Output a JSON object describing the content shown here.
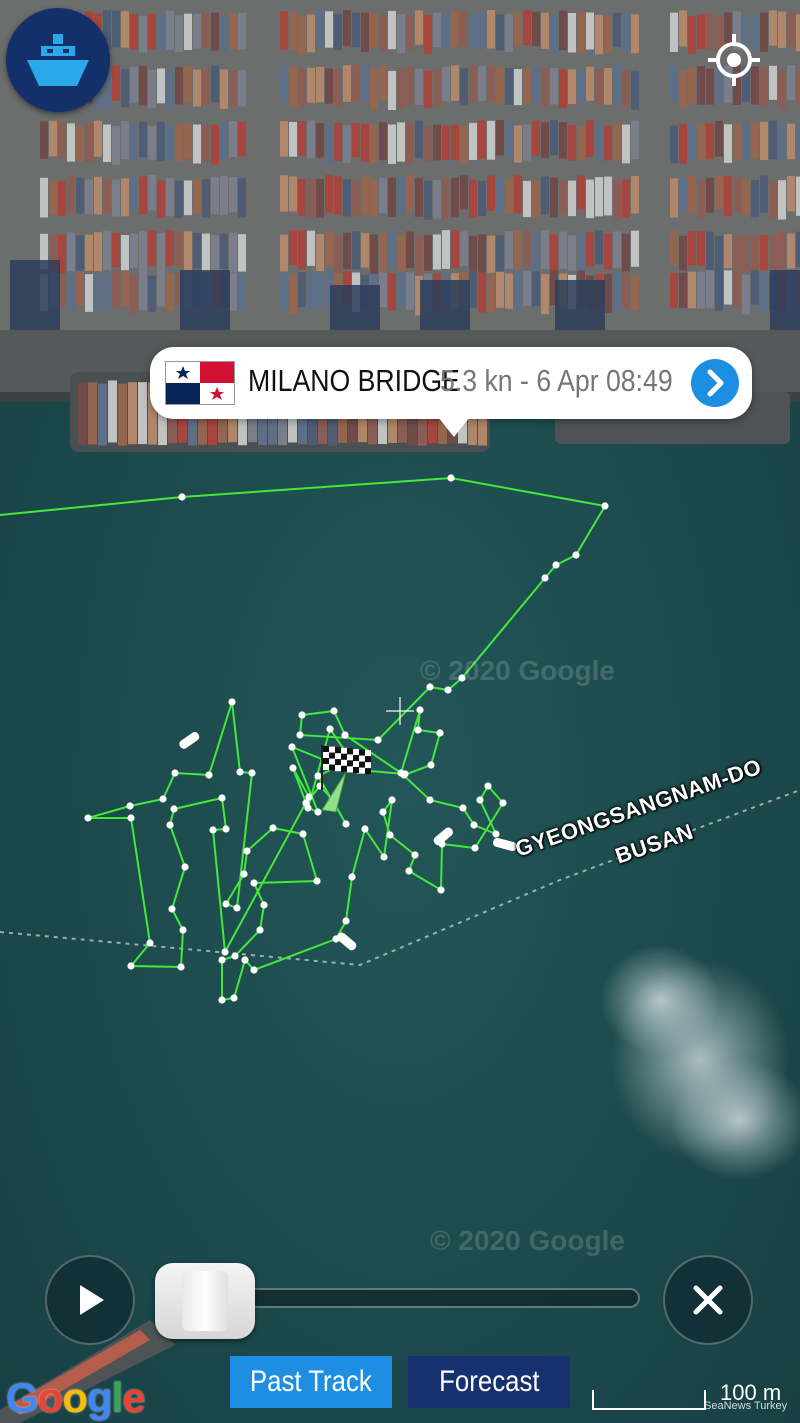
{
  "app": {
    "logo_icon": "ship-icon",
    "locate_icon": "locate-icon"
  },
  "vessel": {
    "name": "MILANO BRIDGE",
    "info": "5.3 kn - 6 Apr 08:49",
    "flag_country": "Panama",
    "flag_icon": "panama-flag-icon",
    "details_icon": "chevron-right-icon",
    "track_color": "#44e83a"
  },
  "map": {
    "region_labels": [
      "GYEONGSANGNAM-DO",
      "BUSAN"
    ],
    "watermarks": [
      "© 2020 Google",
      "© 2020 Google"
    ]
  },
  "playback": {
    "play_icon": "play-icon",
    "close_icon": "close-icon",
    "progress": 0.0,
    "tabs": [
      {
        "label": "Past Track",
        "active": true
      },
      {
        "label": "Forecast",
        "active": false
      }
    ]
  },
  "footer": {
    "google_logo": "Google",
    "scale_label": "100 m",
    "credit": "SeaNews Turkey"
  },
  "colors": {
    "accent": "#1e8ee3",
    "forecast_tab": "#17306e",
    "water": "#1d4a4c"
  }
}
